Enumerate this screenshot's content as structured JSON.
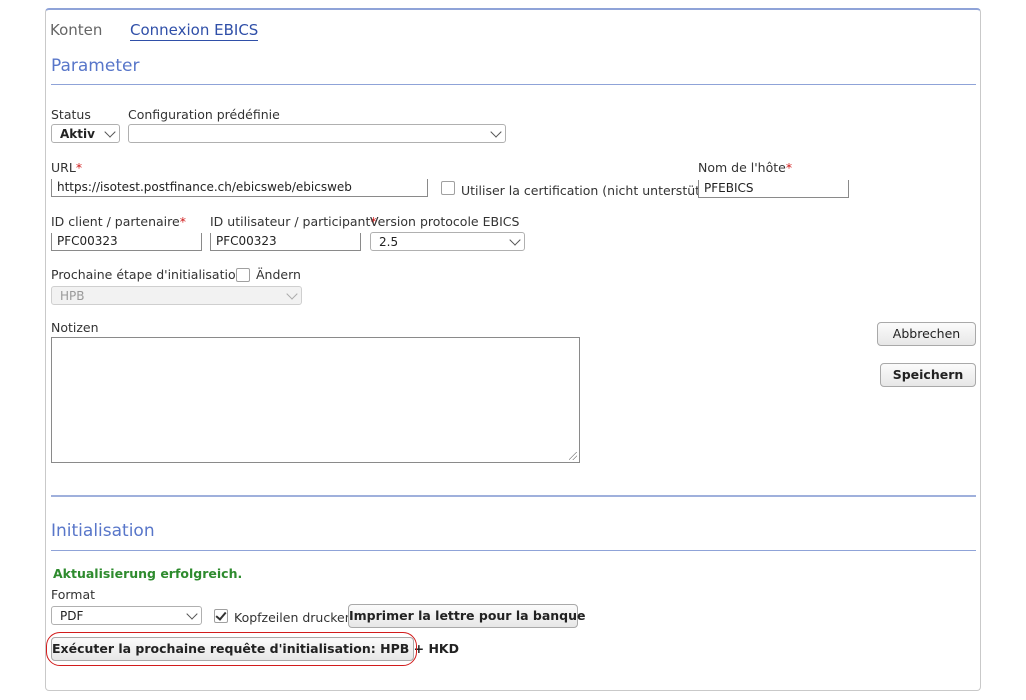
{
  "tabs": [
    {
      "label": "Konten"
    },
    {
      "label": "Connexion EBICS"
    }
  ],
  "parameter": {
    "title": "Parameter",
    "status": {
      "label": "Status",
      "value": "Aktiv"
    },
    "config": {
      "label": "Configuration prédéfinie",
      "value": ""
    },
    "url": {
      "label": "URL",
      "required": "*",
      "value": "https://isotest.postfinance.ch/ebicsweb/ebicsweb"
    },
    "certification": {
      "label": "Utiliser la certification (nicht unterstützt)",
      "checked": false
    },
    "host": {
      "label": "Nom de l'hôte",
      "required": "*",
      "value": "PFEBICS"
    },
    "client_id": {
      "label": "ID client / partenaire",
      "required": "*",
      "value": "PFC00323"
    },
    "user_id": {
      "label": "ID utilisateur / participant",
      "required": "*",
      "value": "PFC00323"
    },
    "protocol": {
      "label": "Version protocole EBICS",
      "value": "2.5"
    },
    "next_step": {
      "label": "Prochaine étape d'initialisation",
      "change_label": "Ändern",
      "value": "HPB"
    },
    "notes": {
      "label": "Notizen",
      "value": ""
    },
    "cancel_label": "Abbrechen",
    "save_label": "Speichern"
  },
  "initialisation": {
    "title": "Initialisation",
    "success_message": "Aktualisierung erfolgreich.",
    "format": {
      "label": "Format",
      "value": "PDF"
    },
    "headers": {
      "label": "Kopfzeilen drucken",
      "checked": true
    },
    "print_button": "Imprimer la lettre pour la banque",
    "execute_button": "Exécuter la prochaine requête d'initialisation: HPB + HKD",
    "highlight_color": "#d21c1c"
  },
  "colors": {
    "accent": "#5876c9",
    "tab_active": "#2f4fa8",
    "required": "#d01a1a",
    "success": "#2e8b2e"
  }
}
